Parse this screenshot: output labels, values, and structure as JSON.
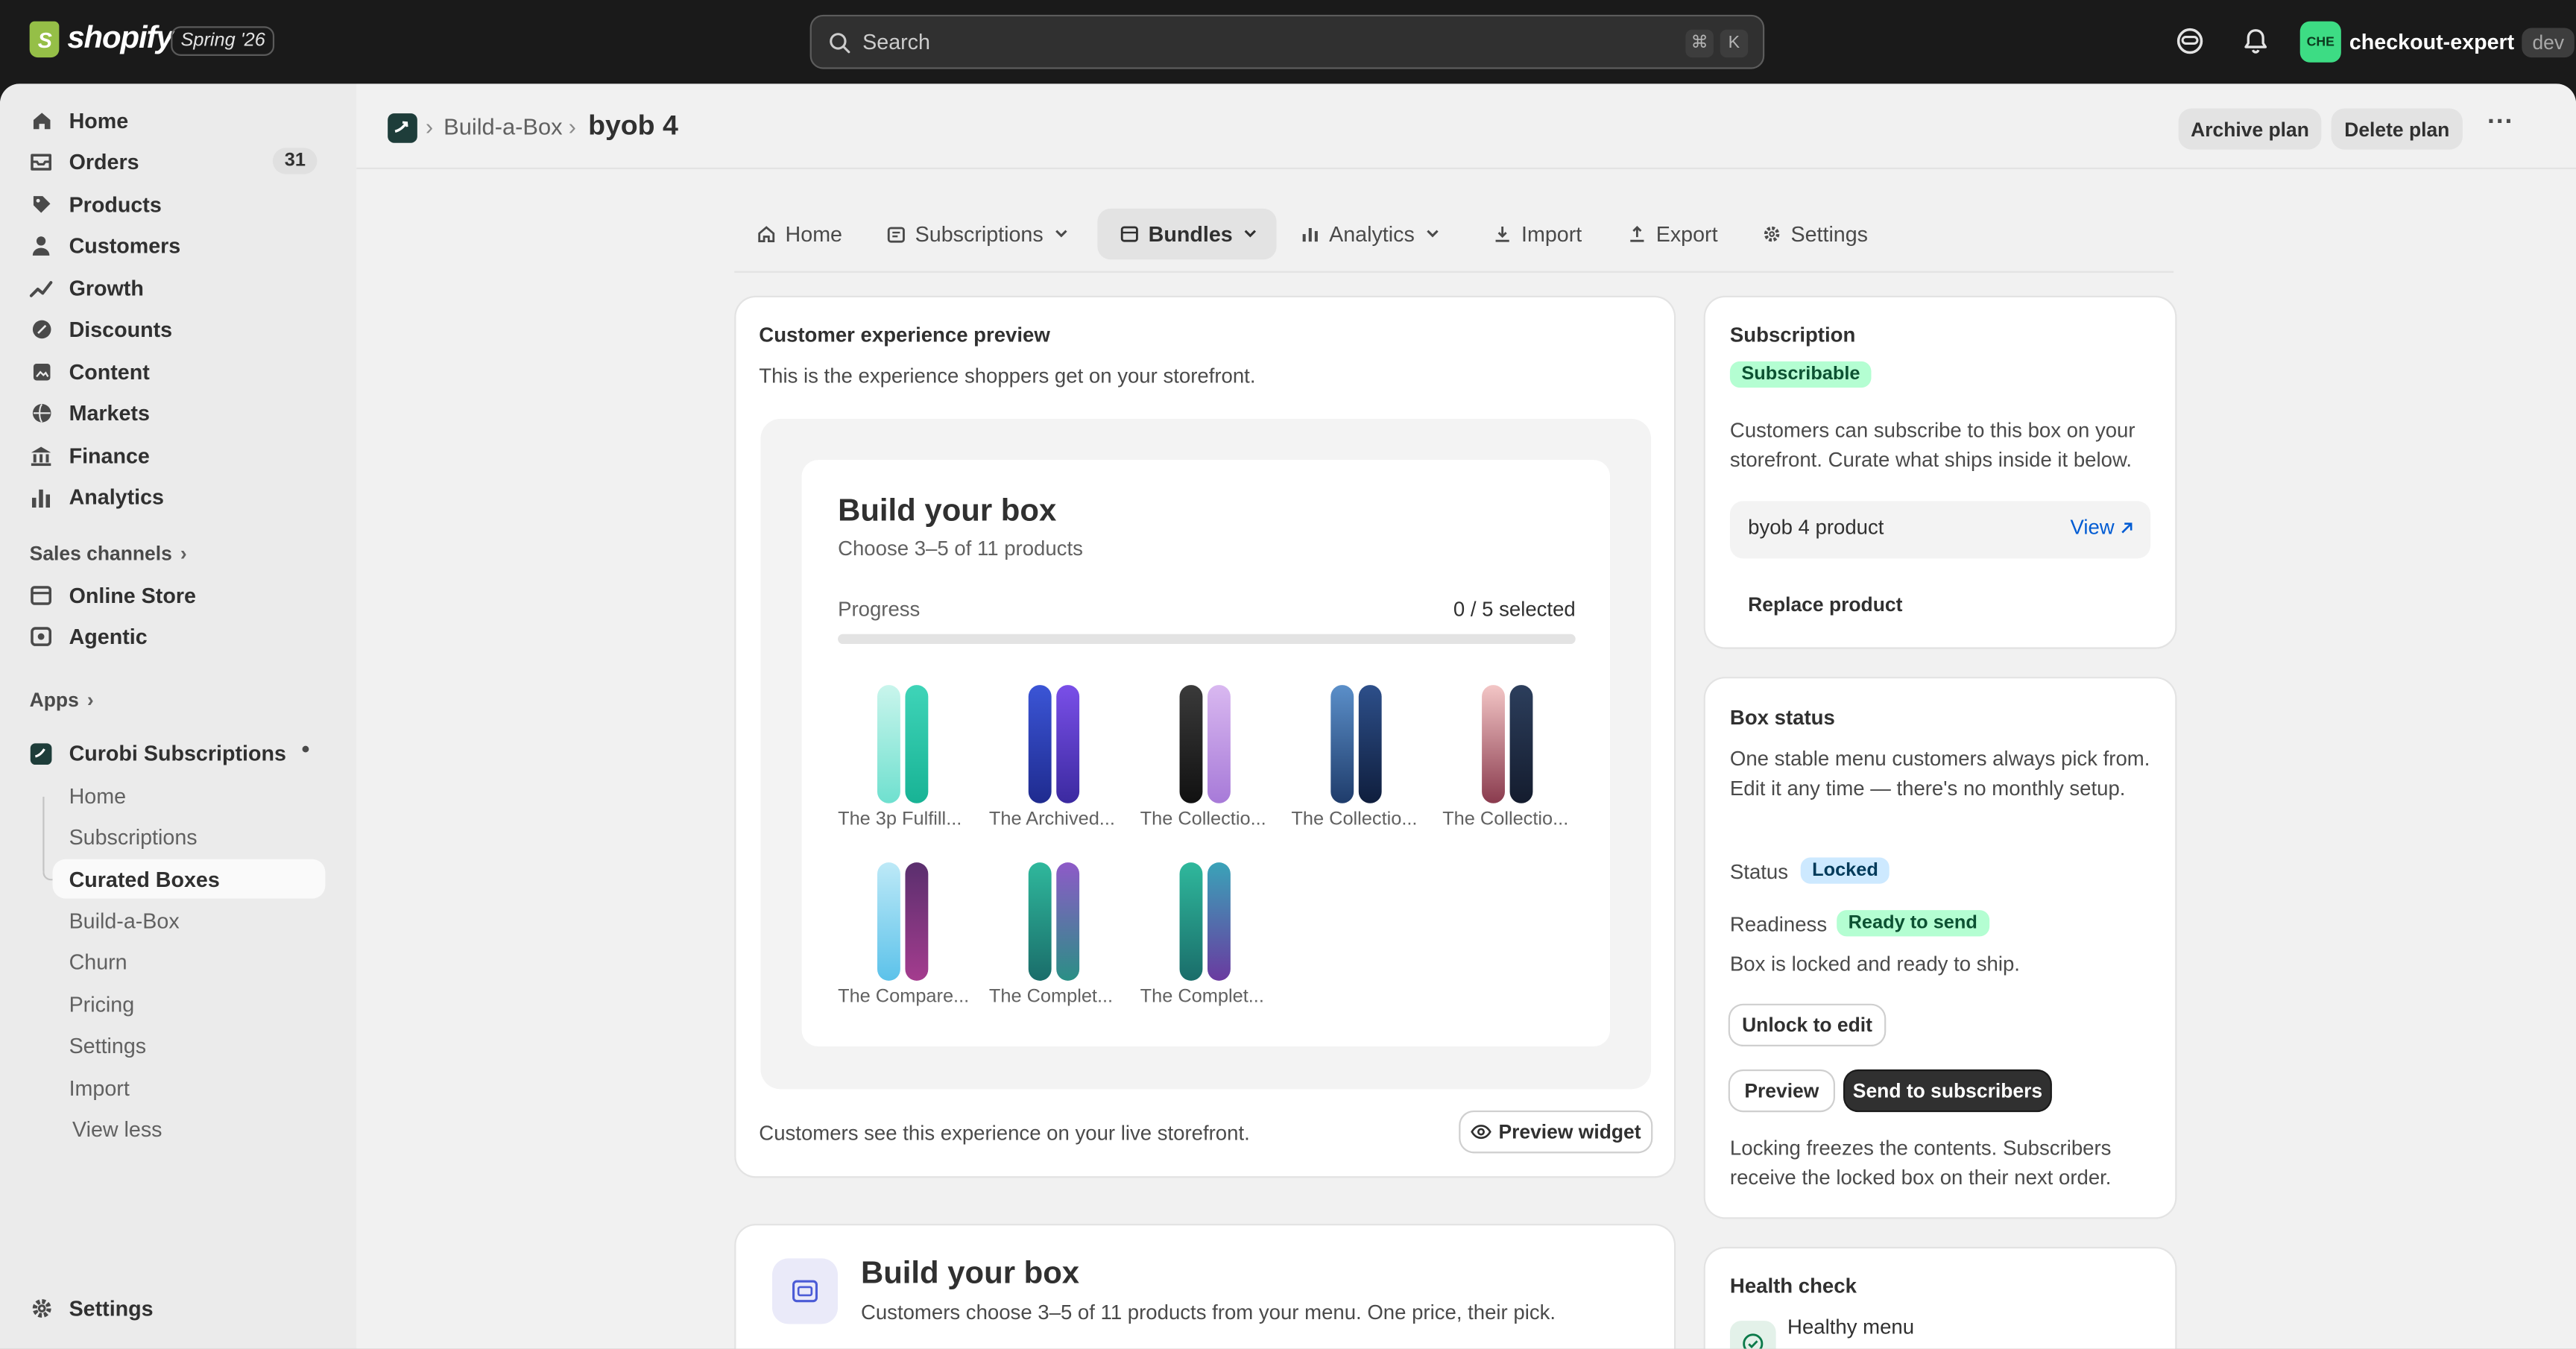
{
  "topbar": {
    "brand": "shopify",
    "version": "Spring '26",
    "search_placeholder": "Search",
    "shortcut_key1": "⌘",
    "shortcut_key2": "K",
    "account_initials": "CHE",
    "account_name": "checkout-expert",
    "account_env": "dev"
  },
  "sidebar": {
    "items": [
      {
        "label": "Home",
        "icon": "home-icon"
      },
      {
        "label": "Orders",
        "icon": "orders-icon",
        "badge": "31"
      },
      {
        "label": "Products",
        "icon": "tag-icon"
      },
      {
        "label": "Customers",
        "icon": "person-icon"
      },
      {
        "label": "Growth",
        "icon": "growth-icon"
      },
      {
        "label": "Discounts",
        "icon": "discount-icon"
      },
      {
        "label": "Content",
        "icon": "content-icon"
      },
      {
        "label": "Markets",
        "icon": "globe-icon"
      },
      {
        "label": "Finance",
        "icon": "bank-icon"
      },
      {
        "label": "Analytics",
        "icon": "bar-chart-icon"
      }
    ],
    "sales_channels_label": "Sales channels",
    "channels": [
      {
        "label": "Online Store",
        "icon": "store-icon"
      },
      {
        "label": "Agentic",
        "icon": "agentic-icon"
      }
    ],
    "apps_label": "Apps",
    "app_name": "Curobi Subscriptions",
    "app_subitems": [
      {
        "label": "Home"
      },
      {
        "label": "Subscriptions"
      },
      {
        "label": "Curated Boxes"
      },
      {
        "label": "Build-a-Box"
      },
      {
        "label": "Churn"
      },
      {
        "label": "Pricing"
      },
      {
        "label": "Settings"
      },
      {
        "label": "Import"
      }
    ],
    "view_less": "View less",
    "settings_label": "Settings"
  },
  "page": {
    "breadcrumb": "Build-a-Box",
    "title": "byob 4",
    "archive_label": "Archive plan",
    "delete_label": "Delete plan",
    "more_label": "···"
  },
  "tabs": [
    {
      "label": "Home",
      "icon": "home-icon"
    },
    {
      "label": "Subscriptions",
      "icon": "subscriptions-icon"
    },
    {
      "label": "Bundles",
      "icon": "bundles-icon"
    },
    {
      "label": "Analytics",
      "icon": "bar-chart-icon"
    },
    {
      "label": "Import",
      "icon": "import-icon"
    },
    {
      "label": "Export",
      "icon": "export-icon"
    },
    {
      "label": "Settings",
      "icon": "gear-icon"
    }
  ],
  "preview": {
    "title": "Customer experience preview",
    "desc": "This is the experience shoppers get on your storefront.",
    "box_title": "Build your box",
    "box_sub": "Choose 3–5 of 11 products",
    "progress_label": "Progress",
    "progress_value": "0 / 5 selected",
    "progress_fraction": 0,
    "products": [
      {
        "name": "The 3p Fulfill..."
      },
      {
        "name": "The Archived..."
      },
      {
        "name": "The Collectio..."
      },
      {
        "name": "The Collectio..."
      },
      {
        "name": "The Collectio..."
      },
      {
        "name": "The Compare..."
      },
      {
        "name": "The Complet..."
      },
      {
        "name": "The Complet..."
      }
    ],
    "footer": "Customers see this experience on your live storefront.",
    "widget_button": "Preview widget"
  },
  "second_card": {
    "title": "Build your box",
    "desc": "Customers choose 3–5 of 11 products from your menu. One price, their pick."
  },
  "subscription": {
    "title": "Subscription",
    "badge": "Subscribable",
    "desc": "Customers can subscribe to this box on your storefront. Curate what ships inside it below.",
    "product_name": "byob 4 product",
    "view_link": "View",
    "replace_label": "Replace product"
  },
  "box_status": {
    "title": "Box status",
    "desc": "One stable menu customers always pick from. Edit it any time — there's no monthly setup.",
    "status_label": "Status",
    "status_value": "Locked",
    "readiness_label": "Readiness",
    "readiness_value": "Ready to send",
    "ready_text": "Box is locked and ready to ship.",
    "unlock_label": "Unlock to edit",
    "preview_label": "Preview",
    "send_label": "Send to subscribers",
    "footer": "Locking freezes the contents. Subscribers receive the locked box on their next order."
  },
  "health": {
    "title": "Health check",
    "item": "Healthy menu"
  },
  "colors": {
    "topbar": "#1a1a1a",
    "success_badge": "#b4fed2",
    "info_badge": "#cde9ff",
    "avatar": "#3ddc84",
    "link": "#005bd3"
  }
}
